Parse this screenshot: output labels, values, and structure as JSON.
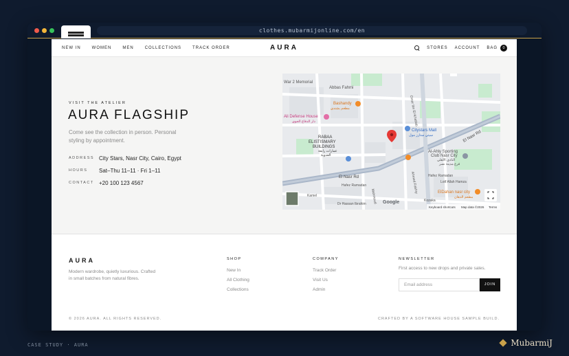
{
  "browser": {
    "url": "clothes.mubarmijonline.com/en"
  },
  "nav": {
    "left": [
      "NEW IN",
      "WOMEN",
      "MEN",
      "COLLECTIONS",
      "TRACK ORDER"
    ],
    "logo": "AURA",
    "stores": "STORES",
    "account": "ACCOUNT",
    "bag": "BAG",
    "bag_count": "0"
  },
  "visit": {
    "eyebrow": "VISIT THE ATELIER",
    "title": "AURA FLAGSHIP",
    "intro": "Come see the collection in person. Personal styling by appointment.",
    "rows": [
      {
        "label": "ADDRESS",
        "value": "City Stars, Nasr City, Cairo, Egypt"
      },
      {
        "label": "HOURS",
        "value": "Sat–Thu 11–11 · Fri 1–11"
      },
      {
        "label": "CONTACT",
        "value": "+20 100 123 4567"
      }
    ]
  },
  "map": {
    "labels": {
      "war_memorial": "War 2 Memorial",
      "abbas": "Abbas Fahmi",
      "bashandy": "Bashandy",
      "bashandy_ar": "مطعم بشندي",
      "ali_defense": "Ali Defense House",
      "ali_defense_ar": "دار الدفاع الجوي",
      "citystars": "Citystars Mall",
      "citystars_ar": "سيتي ستارز مول",
      "rabaa": "RABAA",
      "elistismary": "ELISTISMARY",
      "buildings": "BUILDINGS",
      "rabaa_ar": "عمارات رابعة",
      "rabaa_ar2": "العدوية",
      "ahly": "Al-Ahly Sporting",
      "ahly2": "Club Nasr City",
      "ahly_ar": "النادي الأهلي",
      "ahly_ar2": "فرع مدينة نصر",
      "el_nasr": "El Nasr Rd",
      "el_nasr2": "El Nasr Rd",
      "omar": "Omar Ibn El-Khattab",
      "ahmed_fakhry": "Ahmed Fakhry",
      "mahmoud": "Mahmoud",
      "hafez": "Hafez Ramadan",
      "hafez2": "Hafez Ramadan",
      "lotf": "Lotf Allah Hamza",
      "eldahan": "ElDahan nasr city",
      "eldahan_ar": "مطعم الدهان",
      "kamel": "Kamel",
      "hassan": "Dr Hassan Ibrahim",
      "kozaka": "Kozaka",
      "google": "Google",
      "shortcuts": "Keyboard shortcuts",
      "mapdata": "Map data ©2026",
      "terms": "Terms"
    },
    "colors": {
      "road": "#aab7c9",
      "park": "#c8ebcf",
      "pin": "#e53935"
    }
  },
  "footer": {
    "logo": "AURA",
    "tagline": "Modern wardrobe, quietly luxurious. Crafted in small batches from natural fibres.",
    "shop": {
      "title": "SHOP",
      "links": [
        "New In",
        "All Clothing",
        "Collections"
      ]
    },
    "company": {
      "title": "COMPANY",
      "links": [
        "Track Order",
        "Visit Us",
        "Admin"
      ]
    },
    "newsletter": {
      "title": "NEWSLETTER",
      "text": "First access to new drops and private sales.",
      "placeholder": "Email address",
      "button": "JOIN"
    },
    "copyright": "© 2026 AURA. ALL RIGHTS RESERVED.",
    "credit": "CRAFTED BY A SOFTWARE HOUSE SAMPLE BUILD."
  },
  "page": {
    "caption": "CASE STUDY · AURA",
    "brand": "MubarmiJ"
  }
}
